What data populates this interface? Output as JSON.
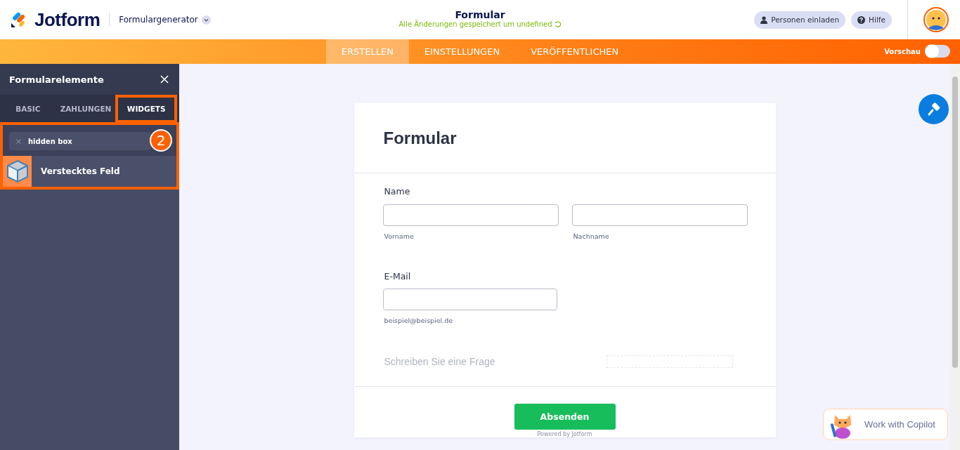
{
  "header": {
    "logo_text": "Jotform",
    "product": "Formulargenerator",
    "title": "Formular",
    "save_status": "Alle Änderungen gespeichert um undefined",
    "buttons": [
      {
        "label": "Personen einladen",
        "kind": "invite"
      },
      {
        "label": "Hilfe",
        "kind": "help"
      }
    ]
  },
  "nav": {
    "tabs": [
      {
        "label": "ERSTELLEN",
        "selected": true
      },
      {
        "label": "EINSTELLUNGEN",
        "selected": false
      },
      {
        "label": "VERÖFFENTLICHEN",
        "selected": false
      }
    ],
    "preview": {
      "label": "Vorschau",
      "on": false
    }
  },
  "sidebar": {
    "title": "Formularelemente",
    "tabs": [
      {
        "label": "BASIC",
        "selected": false
      },
      {
        "label": "ZAHLUNGEN",
        "selected": false
      },
      {
        "label": "WIDGETS",
        "selected": true
      }
    ],
    "search": {
      "value": "hidden box"
    },
    "results": [
      {
        "label": "Verstecktes Feld"
      }
    ],
    "step_badge": "2"
  },
  "form": {
    "title": "Formular",
    "name": {
      "label": "Name",
      "sublabels": [
        "Vorname",
        "Nachname"
      ]
    },
    "email": {
      "label": "E-Mail",
      "sublabel": "beispiel@beispiel.de"
    },
    "question_placeholder": "Schreiben Sie eine Frage",
    "submit": "Absenden",
    "footer": "Powered by Jotform"
  },
  "copilot": {
    "label": "Work with Copilot"
  }
}
